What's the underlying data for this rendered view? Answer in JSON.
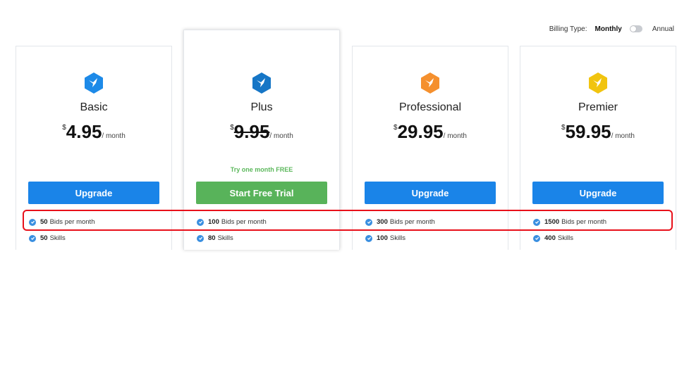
{
  "billing": {
    "label": "Billing Type:",
    "monthly": "Monthly",
    "annual": "Annual",
    "selected": "Monthly"
  },
  "plans": [
    {
      "name": "Basic",
      "icon": "hummingbird-icon",
      "color": "#1d8ae8",
      "currency": "$",
      "price": "4.95",
      "period": "/ month",
      "struck": false,
      "promo": "",
      "button": "Upgrade",
      "button_color": "#1a84e8",
      "features": [
        {
          "value": "50",
          "label": "Bids per month"
        },
        {
          "value": "50",
          "label": "Skills"
        }
      ]
    },
    {
      "name": "Plus",
      "icon": "hummingbird-icon",
      "color": "#1676c6",
      "currency": "$",
      "price": "9.95",
      "period": "/ month",
      "struck": true,
      "promo": "Try one month FREE",
      "button": "Start Free Trial",
      "button_color": "#58b35a",
      "features": [
        {
          "value": "100",
          "label": "Bids per month"
        },
        {
          "value": "80",
          "label": "Skills"
        }
      ]
    },
    {
      "name": "Professional",
      "icon": "hummingbird-icon",
      "color": "#f5902e",
      "currency": "$",
      "price": "29.95",
      "period": "/ month",
      "struck": false,
      "promo": "",
      "button": "Upgrade",
      "button_color": "#1a84e8",
      "features": [
        {
          "value": "300",
          "label": "Bids per month"
        },
        {
          "value": "100",
          "label": "Skills"
        }
      ]
    },
    {
      "name": "Premier",
      "icon": "hummingbird-icon",
      "color": "#f1c40f",
      "currency": "$",
      "price": "59.95",
      "period": "/ month",
      "struck": false,
      "promo": "",
      "button": "Upgrade",
      "button_color": "#1a84e8",
      "features": [
        {
          "value": "1500",
          "label": "Bids per month"
        },
        {
          "value": "400",
          "label": "Skills"
        }
      ]
    }
  ],
  "highlight_color": "#e8101a"
}
